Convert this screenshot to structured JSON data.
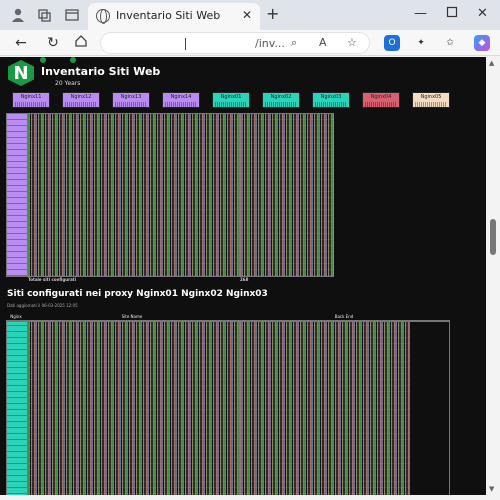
{
  "browser": {
    "tab_title": "Inventario Siti Web",
    "address_fragment": "/inv...",
    "new_tab_symbol": "+",
    "close_symbol": "✕"
  },
  "page": {
    "title": "Inventario Siti Web",
    "subtitle": "20 Years",
    "proxies": [
      {
        "name": "Nginx11",
        "color": "#b88cf0"
      },
      {
        "name": "Nginx12",
        "color": "#b88cf0"
      },
      {
        "name": "Nginx13",
        "color": "#b88cf0"
      },
      {
        "name": "Nginx14",
        "color": "#b88cf0"
      },
      {
        "name": "Nginx01",
        "color": "#2bd3b9"
      },
      {
        "name": "Nginx02",
        "color": "#2bd3b9"
      },
      {
        "name": "Nginx03",
        "color": "#2bd3b9"
      },
      {
        "name": "Nginx04",
        "color": "#d9616f"
      },
      {
        "name": "Nginx05",
        "color": "#f2dcc4"
      }
    ],
    "table1": {
      "total_label": "Totale siti configurati",
      "total_value": "268"
    },
    "section2": {
      "title": "Siti configurati nei proxy Nginx01 Nginx02 Nginx03",
      "updated": "Dati aggiornati il 06-03-2025 12:05",
      "col_index": "Nginx",
      "col_site": "Site Name",
      "col_backend": "Back End"
    }
  }
}
